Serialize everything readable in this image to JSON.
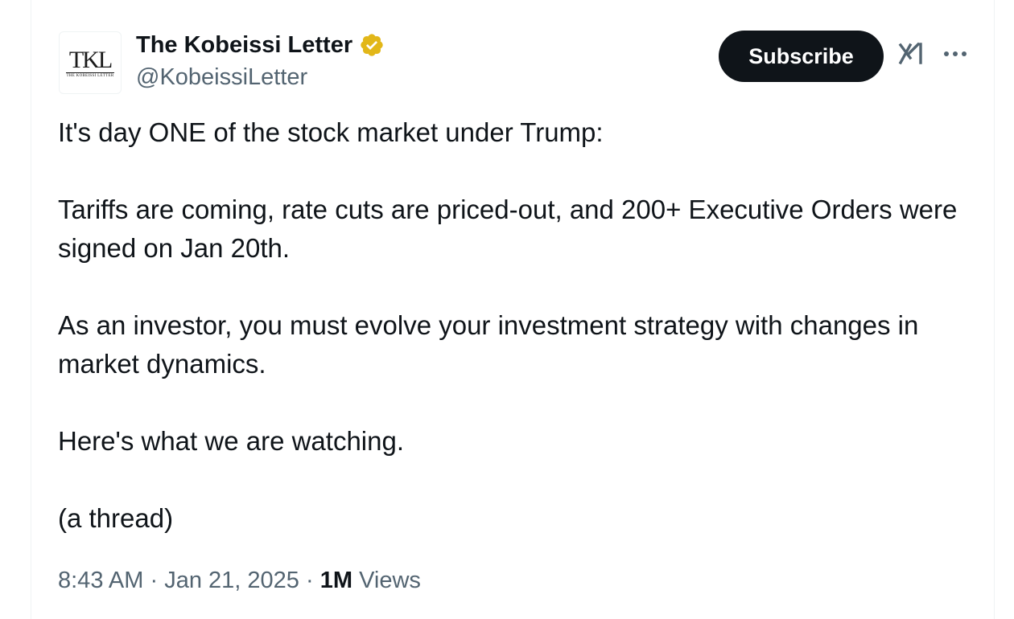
{
  "author": {
    "display_name": "The Kobeissi Letter",
    "handle": "@KobeissiLetter",
    "avatar_logo_text": "TKL",
    "avatar_logo_subtext": "THE KOBEISSI LETTER",
    "verified_icon": "gold-verified-badge-icon",
    "verified_color": "#e2b719"
  },
  "actions": {
    "subscribe_label": "Subscribe",
    "grok_icon": "grok-icon",
    "more_icon": "more-dots-icon"
  },
  "tweet": {
    "paragraphs": [
      "It's day ONE of the stock market under Trump:",
      "Tariffs are coming, rate cuts are priced-out, and 200+ Executive Orders were signed on Jan 20th.",
      "As an investor, you must evolve your investment strategy with changes in market dynamics.",
      "Here's what we are watching.",
      "(a thread)"
    ]
  },
  "meta": {
    "time": "8:43 AM",
    "separator": "·",
    "date": "Jan 21, 2025",
    "views_count": "1M",
    "views_label": "Views"
  },
  "colors": {
    "text_primary": "#0f1419",
    "text_secondary": "#536471",
    "button_bg": "#0f1419"
  }
}
